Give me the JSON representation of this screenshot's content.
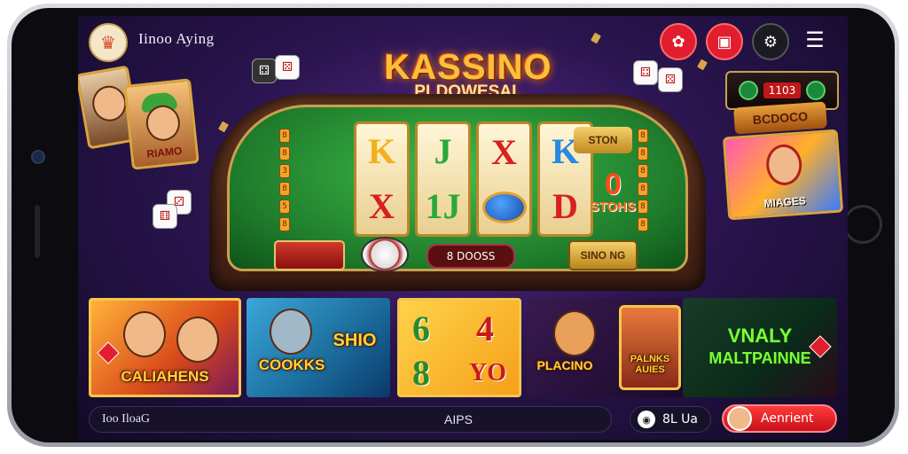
{
  "header": {
    "app_title": "Iinoo Aying",
    "logo_icon": "crown-icon"
  },
  "brand": {
    "main": "KASSINO",
    "sub": "PLDOWESAL"
  },
  "top_icons": [
    "gift-icon",
    "shop-icon",
    "settings-icon",
    "menu-icon"
  ],
  "reels": [
    {
      "top": "K",
      "bottom": "X",
      "top_color": "#f2b01a",
      "bottom_color": "#d82020"
    },
    {
      "top": "J",
      "bottom": "1J",
      "top_color": "#2aa83a",
      "bottom_color": "#2aa83a"
    },
    {
      "top": "X",
      "bottom": "",
      "top_color": "#d82020",
      "bottom_color": "#1a5ad8"
    },
    {
      "top": "K",
      "bottom": "D",
      "top_color": "#2a88e0",
      "bottom_color": "#d82020"
    }
  ],
  "machine": {
    "side_badge": "STON",
    "side_score": "0",
    "side_score_label": "STOHS",
    "center_label": "8 DOOSS",
    "gold_box": "SINO NG"
  },
  "jackpot": {
    "counter": "1103",
    "sign": "BCDOCO",
    "poster_label": "MIAGES"
  },
  "left_poster": {
    "label": "RIAMO"
  },
  "tiles": [
    {
      "title": "CALIAHENS"
    },
    {
      "title": "COOKKS",
      "sub": "SHIO"
    },
    {
      "title": "YO",
      "n1": "6",
      "n2": "4",
      "n3": "8"
    },
    {
      "title": "PLACINO",
      "sub": "PALNKS AUIES"
    },
    {
      "title": "MALTPAINNE",
      "sub": "VNALY"
    }
  ],
  "bottom": {
    "search_text": "Ioo IloaG",
    "center_text": "AIPS",
    "coin_value": "8L Ua",
    "action_label": "Aenrient"
  },
  "colors": {
    "accent_red": "#e21d2d",
    "gold": "#f7c13a",
    "felt_green": "#3ebd4a",
    "bg_purple": "#2b1550"
  }
}
